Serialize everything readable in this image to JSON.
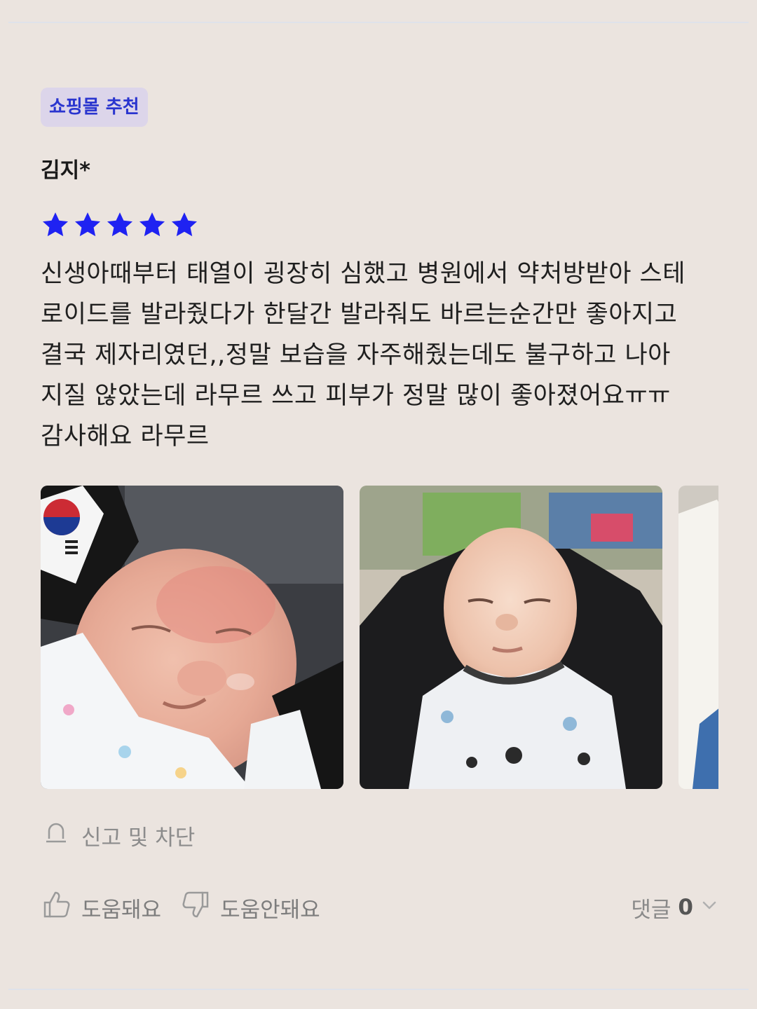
{
  "badge": {
    "label": "쇼핑몰 추천"
  },
  "review": {
    "author": "김지*",
    "rating": 5,
    "rating_max": 5,
    "star_color": "#1f22f2",
    "text": "신생아때부터 태열이 굉장히 심했고 병원에서 약처방받아 스테\n로이드를 발라줬다가 한달간 발라줘도 바르는순간만 좋아지고\n결국 제자리였던,,정말 보습을 자주해줬는데도 불구하고 나아\n지질 않았는데 라무르 쓰고 피부가 정말 많이 좋아졌어요ㅠㅠ\n감사해요 라무르"
  },
  "photos": [
    {
      "alt": "baby-face-rash-photo"
    },
    {
      "alt": "baby-sleeping-photo"
    },
    {
      "alt": "baby-blanket-photo-partial"
    }
  ],
  "actions": {
    "report_label": "신고 및 차단",
    "helpful_label": "도움돼요",
    "not_helpful_label": "도움안돼요",
    "comments_label": "댓글",
    "comments_count": "0"
  },
  "icons": {
    "report": "bell-icon",
    "helpful": "thumbs-up-icon",
    "not_helpful": "thumbs-down-icon",
    "expand": "chevron-down-icon"
  }
}
